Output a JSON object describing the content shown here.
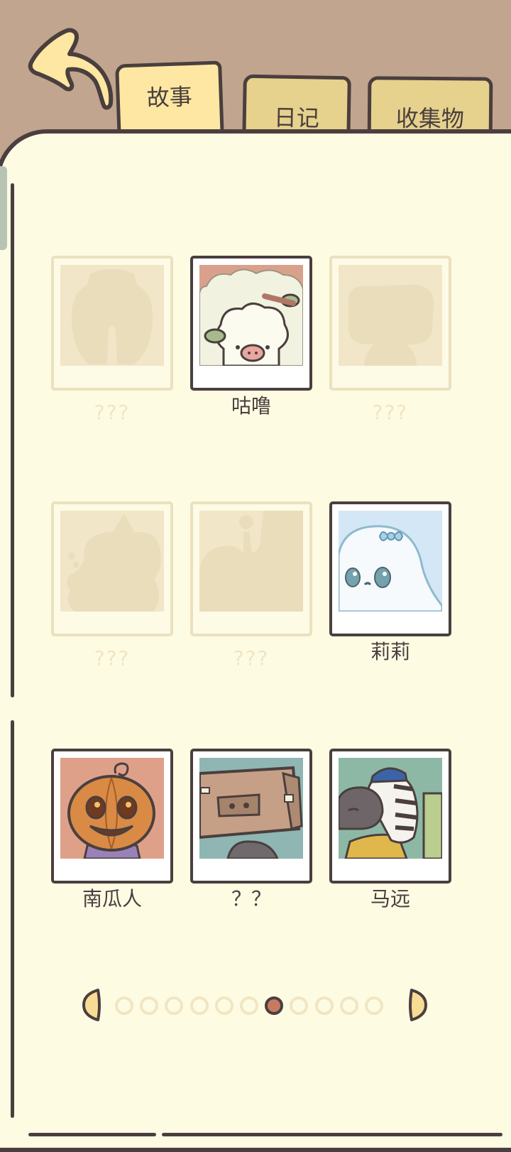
{
  "tabs": [
    {
      "label": "故事",
      "active": true
    },
    {
      "label": "日记",
      "active": false
    },
    {
      "label": "收集物",
      "active": false
    }
  ],
  "cards": [
    {
      "name": "???",
      "unlocked": false
    },
    {
      "name": "咕噜",
      "unlocked": true
    },
    {
      "name": "???",
      "unlocked": false
    },
    {
      "name": "???",
      "unlocked": false
    },
    {
      "name": "???",
      "unlocked": false
    },
    {
      "name": "莉莉",
      "unlocked": true
    },
    {
      "name": "南瓜人",
      "unlocked": true
    },
    {
      "name": "？？",
      "unlocked": true
    },
    {
      "name": "马远",
      "unlocked": true
    }
  ],
  "pagination": {
    "total_pages": 11,
    "current_page": 7
  },
  "colors": {
    "background": "#c2a58e",
    "page": "#fefbe3",
    "outline": "#4a3f3e",
    "tab_active": "#fde7a3",
    "tab_inactive": "#e6d18d",
    "locked_text": "#efe5c4",
    "active_dot": "#c77a62"
  },
  "icons": {
    "back": "back-arrow-icon",
    "prev": "triangle-left-icon",
    "next": "triangle-right-icon"
  }
}
